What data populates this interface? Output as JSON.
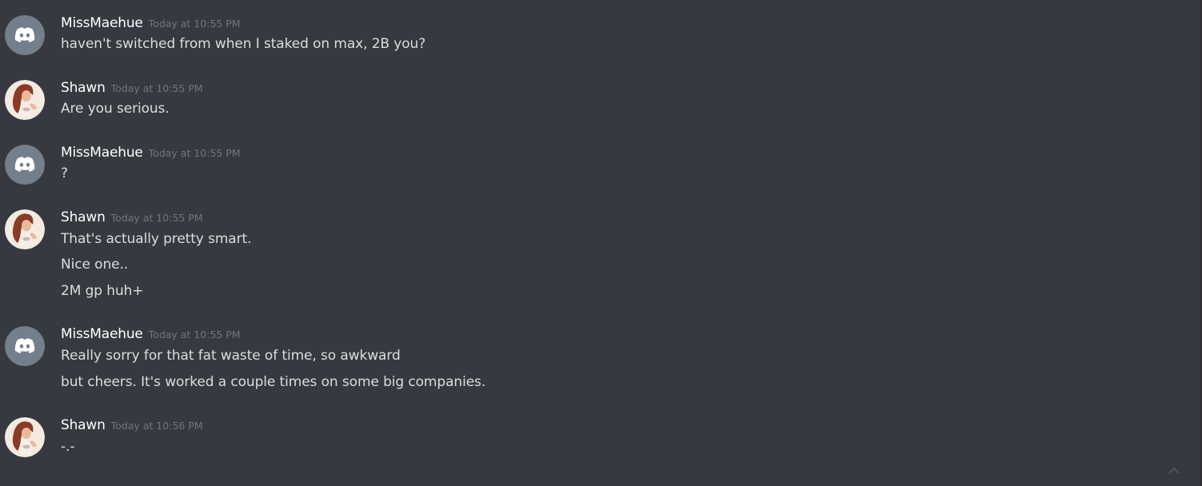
{
  "colors": {
    "background": "#36393f",
    "username": "#ffffff",
    "message_text": "#dcddde",
    "timestamp": "#72767d",
    "discord_avatar_bg": "#747f8d"
  },
  "messages": [
    {
      "author": "MissMaehue",
      "avatar_icon": "discord-default-avatar-icon",
      "timestamp": "Today at 10:55 PM",
      "lines": [
        "haven't switched from when I staked on max, 2B you?"
      ]
    },
    {
      "author": "Shawn",
      "avatar_icon": "profile-picture-avatar",
      "timestamp": "Today at 10:55 PM",
      "lines": [
        "Are you serious."
      ]
    },
    {
      "author": "MissMaehue",
      "avatar_icon": "discord-default-avatar-icon",
      "timestamp": "Today at 10:55 PM",
      "lines": [
        "?"
      ]
    },
    {
      "author": "Shawn",
      "avatar_icon": "profile-picture-avatar",
      "timestamp": "Today at 10:55 PM",
      "lines": [
        "That's actually pretty smart.",
        "Nice one..",
        "2M gp huh+"
      ]
    },
    {
      "author": "MissMaehue",
      "avatar_icon": "discord-default-avatar-icon",
      "timestamp": "Today at 10:55 PM",
      "lines": [
        "Really sorry for that fat waste of time, so awkward",
        "but cheers. It's worked a couple times on some big companies."
      ]
    },
    {
      "author": "Shawn",
      "avatar_icon": "profile-picture-avatar",
      "timestamp": "Today at 10:56 PM",
      "lines": [
        "-.-"
      ]
    }
  ],
  "scroll_button_icon": "chevron-up-icon"
}
